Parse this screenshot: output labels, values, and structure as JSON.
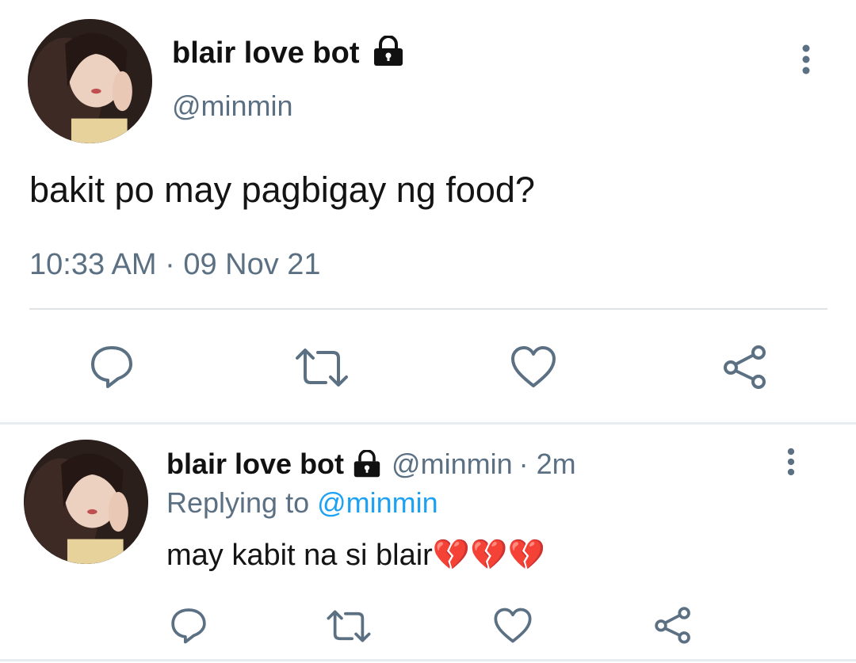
{
  "main_tweet": {
    "author_name": "blair love bot",
    "handle": "@minmin",
    "text": "bakit po may pagbigay ng food?",
    "timestamp": "10:33 AM · 09 Nov 21"
  },
  "reply": {
    "author_name": "blair love bot",
    "handle": "@minmin",
    "age": "· 2m",
    "replying_label": "Replying to",
    "replying_handle": "@minmin",
    "text": "may kabit na si blair",
    "emoji": "💔💔💔"
  },
  "icons": {
    "lock": "lock-icon",
    "more": "more-vertical-icon",
    "reply": "reply-icon",
    "retweet": "retweet-icon",
    "like": "heart-icon",
    "share": "share-icon"
  },
  "colors": {
    "link": "#1da1f2",
    "secondary_text": "#5b7083",
    "icon": "#5b7083",
    "divider": "#dfe3e6"
  }
}
